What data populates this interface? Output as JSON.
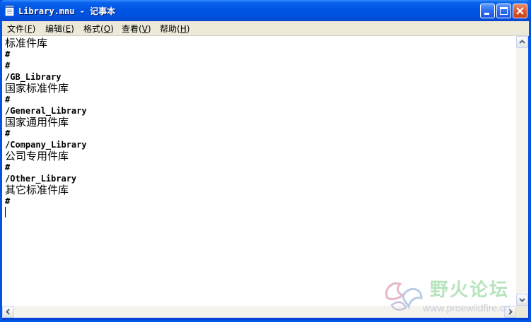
{
  "window": {
    "title": "Library.mnu - 记事本",
    "controls": {
      "minimize_icon": "minimize-icon",
      "maximize_icon": "maximize-icon",
      "close_icon": "close-icon"
    }
  },
  "menubar": {
    "items": [
      {
        "label": "文件",
        "accel": "F"
      },
      {
        "label": "编辑",
        "accel": "E"
      },
      {
        "label": "格式",
        "accel": "O"
      },
      {
        "label": "查看",
        "accel": "V"
      },
      {
        "label": "帮助",
        "accel": "H"
      }
    ]
  },
  "editor": {
    "lines": [
      "标准件库",
      "#",
      "#",
      "/GB_Library",
      "国家标准件库",
      "#",
      "/General_Library",
      "国家通用件库",
      "#",
      "/Company_Library",
      "公司专用件库",
      "#",
      "/Other_Library",
      "其它标准件库",
      "#"
    ]
  },
  "watermark": {
    "title": "野火论坛",
    "url": "www.proewildfire.cn"
  }
}
